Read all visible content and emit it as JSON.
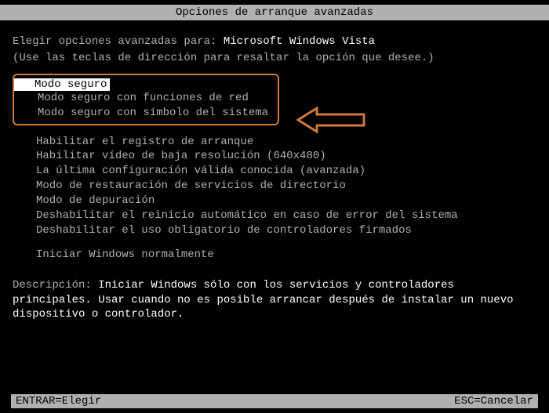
{
  "title": "Opciones de arranque avanzadas",
  "prompt_prefix": "Elegir opciones avanzadas para: ",
  "os_name": "Microsoft Windows Vista",
  "instruction": "(Use las teclas de dirección para resaltar la opción que desee.)",
  "safe_modes": {
    "selected": "Modo seguro",
    "net": "Modo seguro con funciones de red",
    "cmd": "Modo seguro con símbolo del sistema"
  },
  "options": [
    "Habilitar el registro de arranque",
    "Habilitar vídeo de baja resolución (640x480)",
    "La última configuración válida conocida (avanzada)",
    "Modo de restauración de servicios de directorio",
    "Modo de depuración",
    "Deshabilitar el reinicio automático en caso de error del sistema",
    "Deshabilitar el uso obligatorio de controladores firmados"
  ],
  "normal_boot": "Iniciar Windows normalmente",
  "description_label": "Descripción: ",
  "description_text": "Iniciar Windows sólo con los servicios y controladores principales. Usar cuando no es posible arrancar después de instalar un nuevo dispositivo o controlador.",
  "footer": {
    "enter": "ENTRAR=Elegir",
    "esc": "ESC=Cancelar"
  },
  "colors": {
    "accent": "#cc7a3f"
  }
}
